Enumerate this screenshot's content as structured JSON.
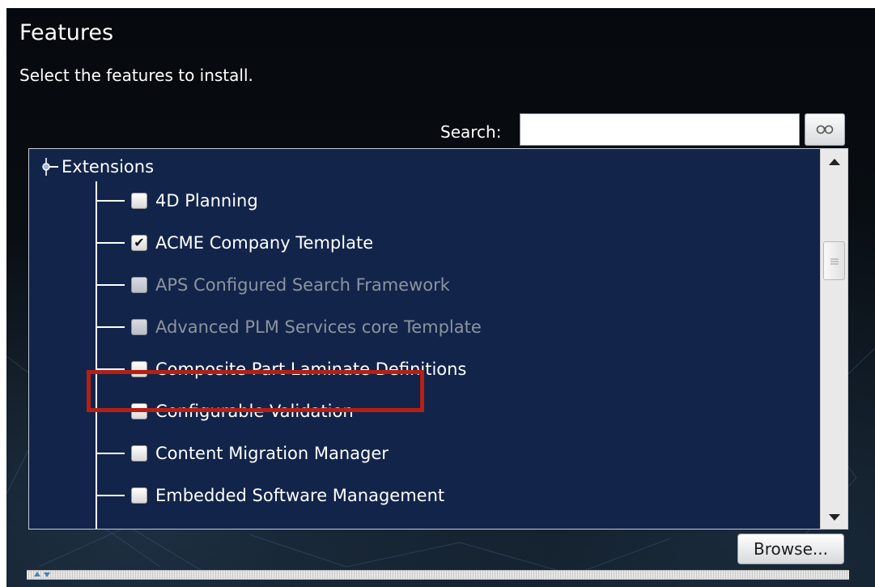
{
  "header": {
    "title": "Features",
    "subtitle": "Select the features to install."
  },
  "search": {
    "label": "Search:",
    "value": "",
    "placeholder": "",
    "button_icon": "binoculars-icon"
  },
  "tree": {
    "root": {
      "label": "Extensions",
      "icon": "tree-node-icon"
    },
    "items": [
      {
        "label": "4D Planning",
        "checked": false,
        "disabled": false
      },
      {
        "label": "ACME Company Template",
        "checked": true,
        "disabled": false,
        "highlighted": true
      },
      {
        "label": "APS Configured Search Framework",
        "checked": false,
        "disabled": true
      },
      {
        "label": "Advanced PLM Services core Template",
        "checked": false,
        "disabled": true
      },
      {
        "label": "Composite Part Laminate Definitions",
        "checked": false,
        "disabled": false
      },
      {
        "label": "Configurable Validation",
        "checked": false,
        "disabled": false
      },
      {
        "label": "Content Migration Manager",
        "checked": false,
        "disabled": false
      },
      {
        "label": "Embedded Software Management",
        "checked": false,
        "disabled": false
      }
    ]
  },
  "footer": {
    "browse_label": "Browse..."
  },
  "colors": {
    "tree_background": "#12244a",
    "highlight_border": "#b52014",
    "disabled_text": "#8c949e",
    "text": "#ffffff"
  }
}
